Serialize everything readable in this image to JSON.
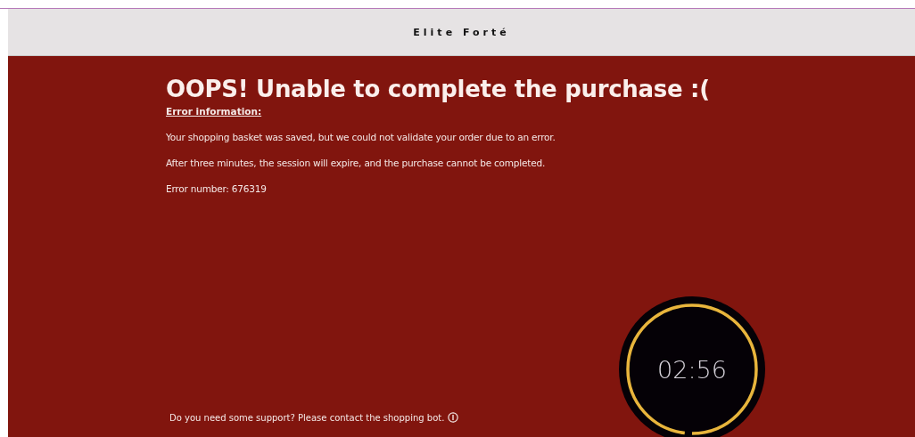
{
  "header": {
    "brand": "Elite Forté"
  },
  "error": {
    "title": "OOPS! Unable to complete the purchase :(",
    "subtitle": "Error information:",
    "paragraphs": [
      "Your shopping basket was saved, but we could not validate your order due to an error.",
      "After three minutes, the session will expire, and the purchase cannot be completed.",
      "Error number: 676319"
    ]
  },
  "support": {
    "text": "Do you need some support? Please contact the shopping bot."
  },
  "timer": {
    "time": "02:56",
    "level": 0.98
  }
}
